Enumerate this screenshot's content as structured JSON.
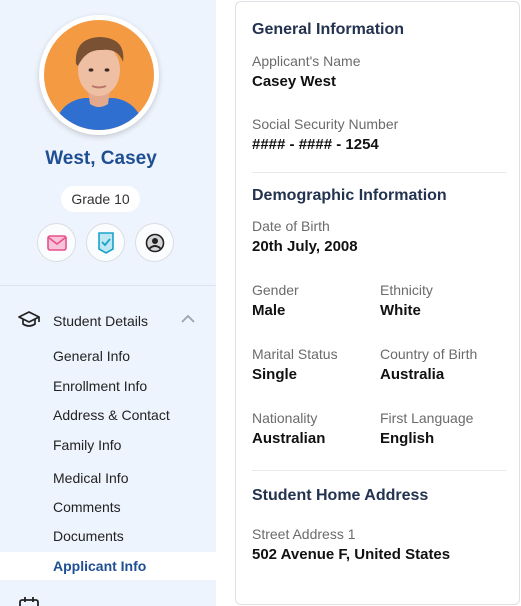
{
  "profile": {
    "name": "West, Casey",
    "grade": "Grade 10"
  },
  "actions": {
    "icons": [
      "mail-icon",
      "checked-document-icon",
      "user-circle-icon"
    ]
  },
  "nav": {
    "section_label": "Student Details",
    "items": [
      "General Info",
      "Enrollment Info",
      "Address & Contact",
      "Family Info",
      "Medical Info",
      "Comments",
      "Documents",
      "Applicant Info"
    ],
    "active_item": "Applicant Info"
  },
  "general": {
    "title": "General Information",
    "applicant_name_label": "Applicant's Name",
    "applicant_name": "Casey West",
    "ssn_label": "Social Security Number",
    "ssn": "#### - #### - 1254"
  },
  "demographic": {
    "title": "Demographic Information",
    "dob_label": "Date of Birth",
    "dob": "20th July, 2008",
    "gender_label": "Gender",
    "gender": "Male",
    "ethnicity_label": "Ethnicity",
    "ethnicity": "White",
    "marital_label": "Marital Status",
    "marital": "Single",
    "country_label": "Country of Birth",
    "country": "Australia",
    "nationality_label": "Nationality",
    "nationality": "Australian",
    "language_label": "First Language",
    "language": "English"
  },
  "address": {
    "title": "Student Home Address",
    "street_label": "Street Address 1",
    "street": "502 Avenue F, United States"
  },
  "colors": {
    "accent": "#1f4f93",
    "sidebar_bg": "#eef4fd",
    "avatar_bg": "#f39a43",
    "mail_icon": "#e94f8a",
    "check_icon": "#1aa3c9"
  }
}
